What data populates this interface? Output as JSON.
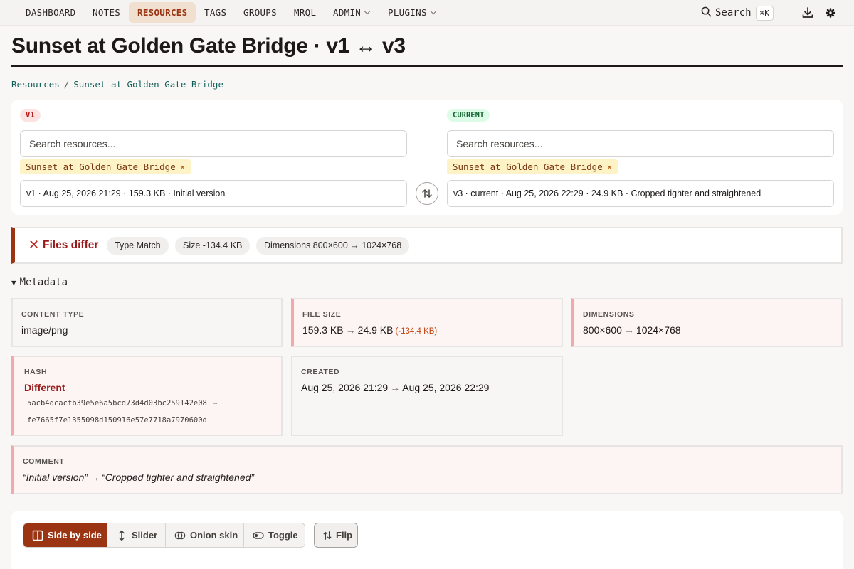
{
  "nav": {
    "items": [
      {
        "label": "DASHBOARD"
      },
      {
        "label": "NOTES"
      },
      {
        "label": "RESOURCES"
      },
      {
        "label": "TAGS"
      },
      {
        "label": "GROUPS"
      },
      {
        "label": "MRQL"
      },
      {
        "label": "ADMIN"
      },
      {
        "label": "PLUGINS"
      }
    ],
    "search_label": "Search",
    "search_shortcut": "⌘K",
    "active_item": "RESOURCES"
  },
  "page": {
    "title": "Sunset at Golden Gate Bridge · v1 ↔ v3",
    "breadcrumb": [
      "Resources",
      "Sunset at Golden Gate Bridge"
    ],
    "breadcrumb_sep": "/"
  },
  "picker": {
    "left": {
      "badge": "V1",
      "search_placeholder": "Search resources...",
      "chip": "Sunset at Golden Gate Bridge",
      "chip_remove": "×",
      "version": "v1 · Aug 25, 2026 21:29 · 159.3 KB · Initial version"
    },
    "right": {
      "badge": "CURRENT",
      "search_placeholder": "Search resources...",
      "chip": "Sunset at Golden Gate Bridge",
      "chip_remove": "×",
      "version": "v3 · current · Aug 25, 2026 22:29 · 24.9 KB · Cropped tighter and straightened"
    }
  },
  "diff": {
    "icon": "✕",
    "status": "Files differ",
    "pills": [
      "Type Match",
      "Size -134.4 KB",
      "Dimensions 800×600 → 1024×768"
    ]
  },
  "metadata": {
    "toggle_icon": "▼",
    "title": "Metadata",
    "arrow": "→",
    "content_type": {
      "label": "CONTENT TYPE",
      "value": "image/png"
    },
    "file_size": {
      "label": "FILE SIZE",
      "from": "159.3 KB",
      "to": "24.9 KB",
      "delta": "(-134.4 KB)"
    },
    "dimensions": {
      "label": "DIMENSIONS",
      "from": "800×600",
      "to": "1024×768"
    },
    "hash": {
      "label": "HASH",
      "status": "Different",
      "from": "5acb4dcacfb39e5e6a5bcd73d4d03bc259142e08",
      "to": "fe7665f7e1355098d150916e57e7718a7970600d"
    },
    "created": {
      "label": "CREATED",
      "from": "Aug 25, 2026 21:29",
      "to": "Aug 25, 2026 22:29"
    },
    "comment": {
      "label": "COMMENT",
      "from": "“Initial version”",
      "to": "“Cropped tighter and straightened”"
    }
  },
  "compare": {
    "modes": [
      {
        "label": "Side by side",
        "icon": "columns-icon"
      },
      {
        "label": "Slider",
        "icon": "vertical-resize-icon"
      },
      {
        "label": "Onion skin",
        "icon": "overlap-circles-icon"
      },
      {
        "label": "Toggle",
        "icon": "toggle-icon"
      }
    ],
    "active_mode": "Side by side",
    "flip_label": "Flip"
  },
  "colors": {
    "accent": "#9a3412",
    "diff_red": "#991b1b",
    "changed_border": "#f3a8ad",
    "link": "#115e59"
  }
}
